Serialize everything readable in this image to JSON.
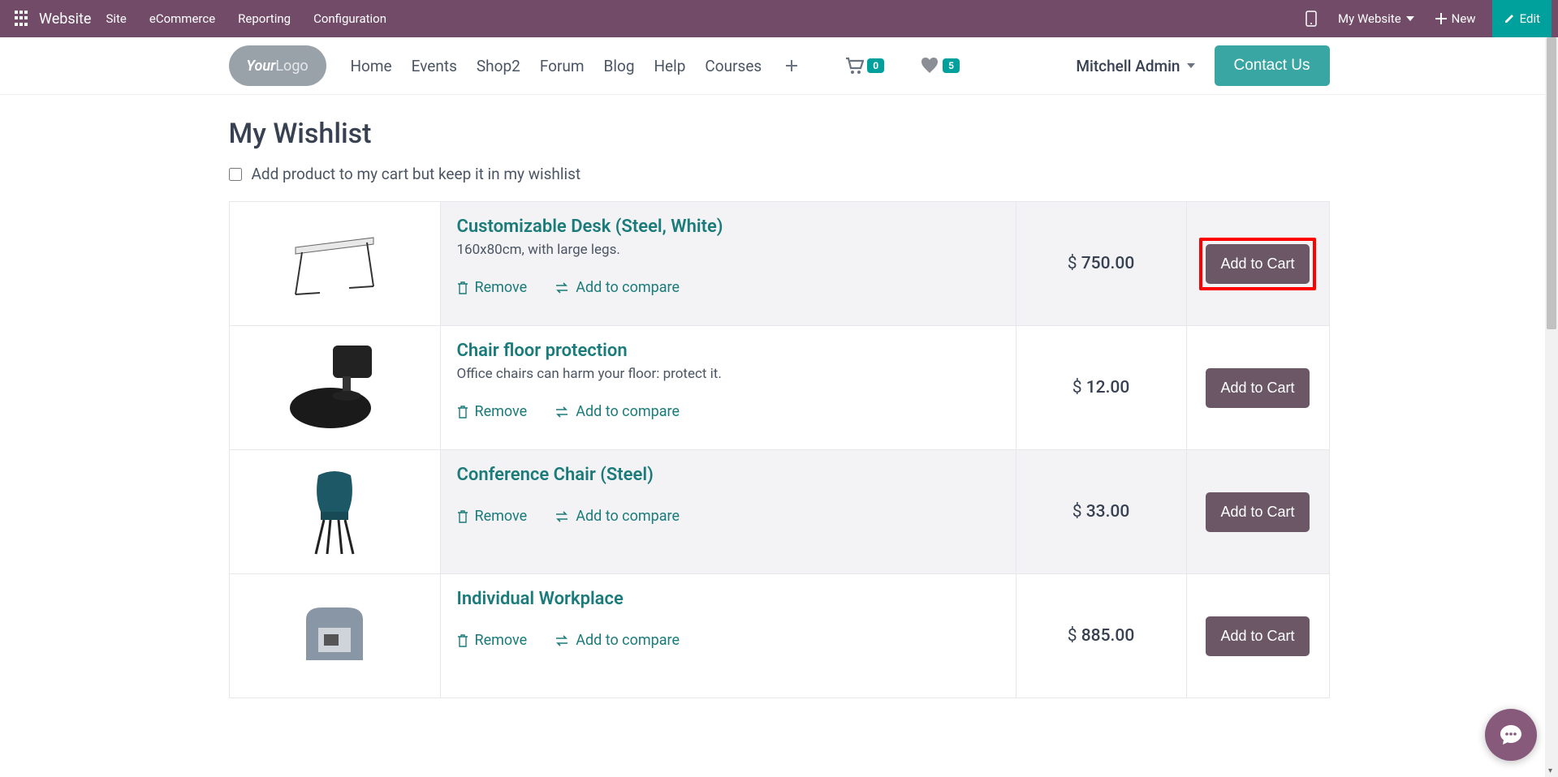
{
  "topbar": {
    "brand": "Website",
    "menu": [
      "Site",
      "eCommerce",
      "Reporting",
      "Configuration"
    ],
    "my_website": "My Website",
    "new": "New",
    "edit": "Edit"
  },
  "header": {
    "logo_your": "Your",
    "logo_logo": "Logo",
    "nav": [
      "Home",
      "Events",
      "Shop2",
      "Forum",
      "Blog",
      "Help",
      "Courses"
    ],
    "cart_count": "0",
    "wish_count": "5",
    "user": "Mitchell Admin",
    "contact": "Contact Us"
  },
  "page": {
    "title": "My Wishlist",
    "keep_label": "Add product to my cart but keep it in my wishlist"
  },
  "labels": {
    "remove": "Remove",
    "compare": "Add to compare",
    "add_to_cart": "Add to Cart",
    "currency": "$"
  },
  "items": [
    {
      "title": "Customizable Desk (Steel, White)",
      "desc": "160x80cm, with large legs.",
      "price": "750.00",
      "highlight": true
    },
    {
      "title": "Chair floor protection",
      "desc": "Office chairs can harm your floor: protect it.",
      "price": "12.00",
      "highlight": false
    },
    {
      "title": "Conference Chair (Steel)",
      "desc": "",
      "price": "33.00",
      "highlight": false
    },
    {
      "title": "Individual Workplace",
      "desc": "",
      "price": "885.00",
      "highlight": false
    }
  ]
}
